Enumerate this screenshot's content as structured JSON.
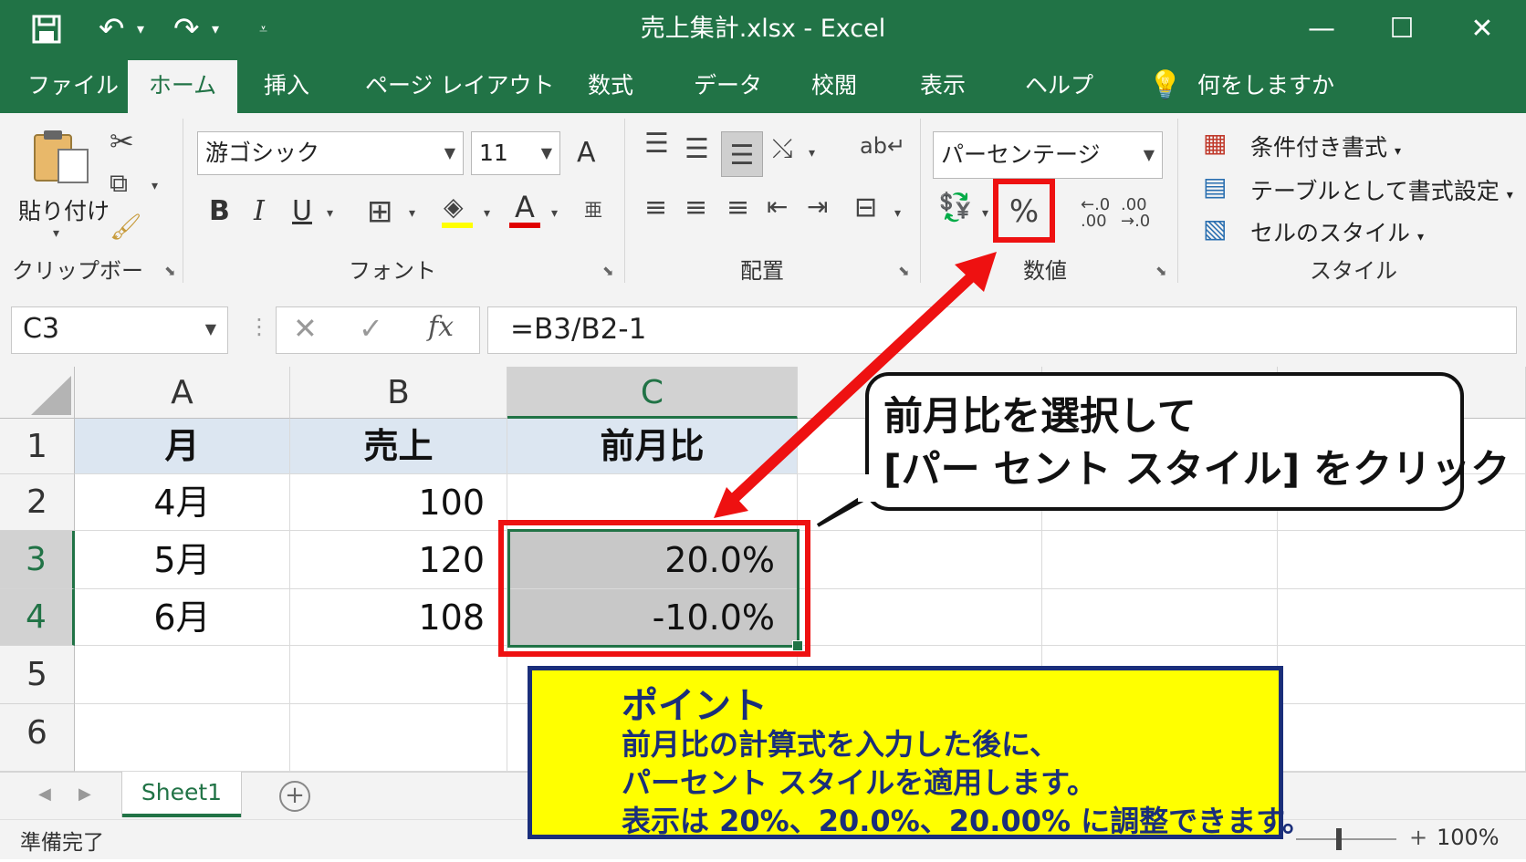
{
  "app": {
    "title": "売上集計.xlsx  -  Excel",
    "quick_access": [
      "save-icon",
      "undo-icon",
      "redo-icon",
      "customize-icon"
    ],
    "window_controls": {
      "minimize": "—",
      "maximize": "☐",
      "close": "✕"
    }
  },
  "tabs": [
    "ファイル",
    "ホーム",
    "挿入",
    "ページ レイアウト",
    "数式",
    "データ",
    "校閲",
    "表示",
    "ヘルプ"
  ],
  "active_tab": "ホーム",
  "tell_me": "何をしますか",
  "ribbon": {
    "clipboard": {
      "paste_label": "貼り付け",
      "group_label": "クリップボード"
    },
    "font": {
      "font_name": "游ゴシック",
      "font_size": "11",
      "bold": "B",
      "italic": "I",
      "underline": "U",
      "font_color_letter": "A",
      "group_label": "フォント",
      "grow_font": "A"
    },
    "alignment": {
      "group_label": "配置"
    },
    "number": {
      "format": "パーセンテージ",
      "percent": "%",
      "inc_decimal_top": "←.0",
      "inc_decimal_bottom": ".00",
      "dec_decimal_top": ".00",
      "dec_decimal_bottom": "→.0",
      "group_label": "数値"
    },
    "styles": {
      "items": [
        "条件付き書式",
        "テーブルとして書式設定",
        "セルのスタイル"
      ],
      "group_label": "スタイル"
    }
  },
  "formula_bar": {
    "name_box": "C3",
    "cancel": "✕",
    "enter": "✓",
    "fx": "fx",
    "formula": "=B3/B2-1"
  },
  "grid": {
    "columns": [
      "A",
      "B",
      "C"
    ],
    "selected_column": "C",
    "rows": [
      "1",
      "2",
      "3",
      "4",
      "5",
      "6"
    ],
    "selected_rows": [
      "3",
      "4"
    ],
    "cells": [
      [
        "月",
        "売上",
        "前月比"
      ],
      [
        "4月",
        "100",
        ""
      ],
      [
        "5月",
        "120",
        "20.0%"
      ],
      [
        "6月",
        "108",
        "-10.0%"
      ],
      [
        "",
        "",
        ""
      ],
      [
        "",
        "",
        ""
      ]
    ]
  },
  "sheet_tabs": {
    "active": "Sheet1",
    "add": "+",
    "nav_prev": "◀",
    "nav_next": "▶"
  },
  "status": {
    "ready": "準備完了",
    "zoom": "100%",
    "zoom_plus": "+"
  },
  "callout": {
    "line1": "前月比を選択して",
    "line2": "[パー セント スタイル] をクリック"
  },
  "point_box": {
    "title": "ポイント",
    "line1": "前月比の計算式を入力した後に、",
    "line2": "パーセント スタイルを適用します。",
    "line3": "表示は 20%、20.0%、20.00% に調整できます。"
  },
  "colors": {
    "excel_green": "#217346",
    "highlight_red": "#ee1111",
    "header_fill": "#dce6f1",
    "point_yellow": "#ffff00",
    "point_border": "#1a2e7a"
  }
}
